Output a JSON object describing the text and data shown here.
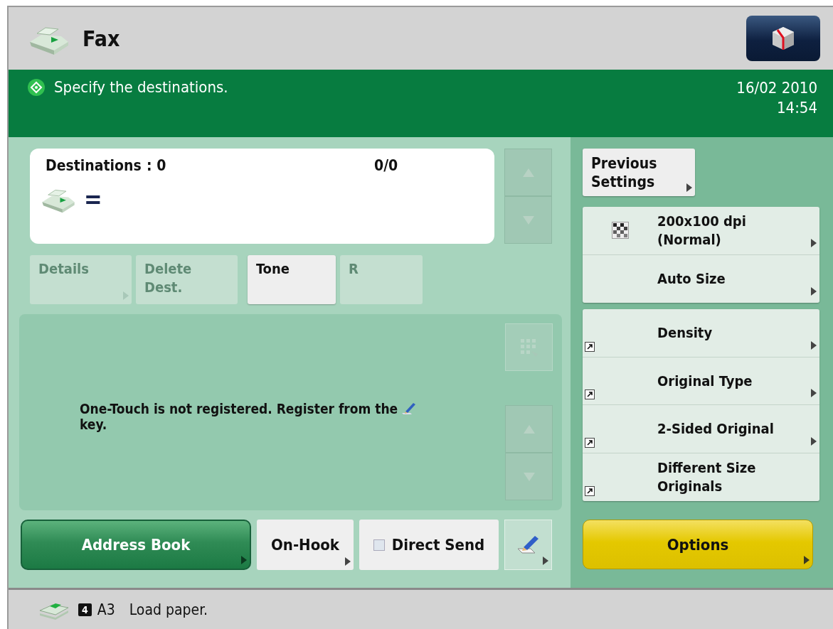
{
  "header": {
    "title": "Fax"
  },
  "message_bar": {
    "text": "Specify the destinations.",
    "date": "16/02 2010",
    "time": "14:54"
  },
  "destinations": {
    "label": "Destinations",
    "count": ": 0",
    "page": "0/0",
    "symbol": "="
  },
  "destination_buttons": [
    {
      "label": "Details",
      "disabled": true,
      "arrow": true
    },
    {
      "label": "Delete Dest.",
      "disabled": true,
      "arrow": false
    },
    {
      "label": "Tone",
      "disabled": false,
      "arrow": false
    },
    {
      "label": "R",
      "disabled": true,
      "arrow": false
    }
  ],
  "one_touch": {
    "message_before": "One-Touch is not registered. Register from the",
    "message_after": "key."
  },
  "bottom_buttons": [
    {
      "kind": "primary",
      "label": "Address Book",
      "arrow": true
    },
    {
      "kind": "plain",
      "label": "On-Hook",
      "arrow": true
    },
    {
      "kind": "checkbox",
      "label": "Direct Send",
      "checked": false,
      "arrow": false
    },
    {
      "kind": "icon",
      "arrow": true
    }
  ],
  "previous_settings": {
    "label": "Previous Settings",
    "arrow": true
  },
  "setting_groups": [
    [
      {
        "kind": "resolution",
        "label": "200x100 dpi (Normal)",
        "arrow": true,
        "shortcut": false
      },
      {
        "kind": "plain",
        "label": "Auto Size",
        "arrow": true,
        "shortcut": false
      }
    ],
    [
      {
        "kind": "plain",
        "label": "Density",
        "arrow": true,
        "shortcut": true
      },
      {
        "kind": "plain",
        "label": "Original Type",
        "arrow": true,
        "shortcut": true
      },
      {
        "kind": "plain",
        "label": "2-Sided Original",
        "arrow": true,
        "shortcut": true
      },
      {
        "kind": "plain",
        "label": "Different Size Originals",
        "arrow": false,
        "shortcut": true
      }
    ]
  ],
  "options_button": {
    "label": "Options",
    "arrow": true
  },
  "status_bar": {
    "drawer": "4",
    "paper_size": "A3",
    "message": "Load paper."
  }
}
